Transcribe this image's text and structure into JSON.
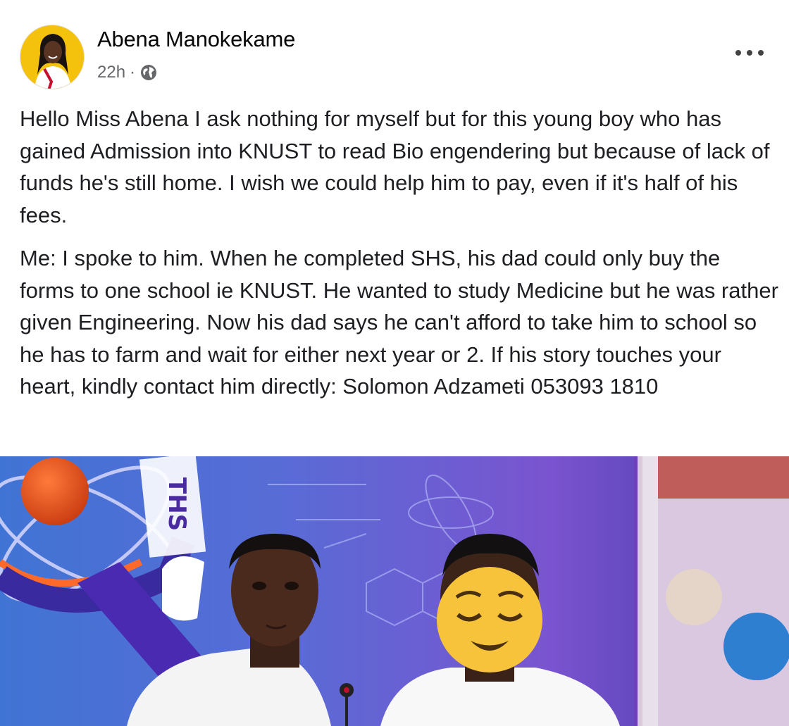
{
  "post": {
    "author": "Abena Manokekame",
    "time": "22h",
    "separator": "·",
    "privacy_icon": "globe-icon",
    "more_icon": "more-dots-icon",
    "paragraphs": [
      "Hello Miss Abena I ask nothing for myself but for this young boy who has gained Admission into KNUST to read Bio engendering but because of lack of funds he's still home. I wish we could help him to pay, even if it's half of his fees.",
      "Me: I spoke to him. When he completed SHS, his dad could only buy the forms to one school ie KNUST. He wanted to study Medicine but he was rather given Engineering. Now his dad says he can't afford to take him to school so he has to farm and wait for either next year or 2. If his story touches your heart, kindly contact him directly: Solomon Adzameti 053093 1810"
    ]
  },
  "photo": {
    "banner_text": "THS",
    "emoji_icon": "relieved-face-emoji-icon"
  },
  "colors": {
    "meta_gray": "#65676b",
    "text": "#1c1e21",
    "avatar_bg": "#f4c20d",
    "photo_bg": "#6a5cd6"
  }
}
